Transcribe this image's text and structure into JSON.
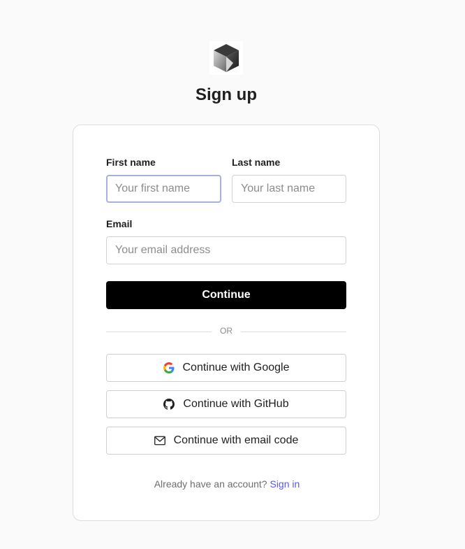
{
  "header": {
    "logo_icon": "cube-logo",
    "title": "Sign up"
  },
  "form": {
    "first_name": {
      "label": "First name",
      "value": "",
      "placeholder": "Your first name"
    },
    "last_name": {
      "label": "Last name",
      "value": "",
      "placeholder": "Your last name"
    },
    "email": {
      "label": "Email",
      "value": "",
      "placeholder": "Your email address"
    },
    "continue_label": "Continue",
    "divider_text": "OR"
  },
  "social": {
    "google_label": "Continue with Google",
    "google_icon": "google-icon",
    "github_label": "Continue with GitHub",
    "github_icon": "github-icon",
    "email_code_label": "Continue with email code",
    "email_code_icon": "mail-icon"
  },
  "footer": {
    "prompt": "Already have an account?",
    "signin_label": "Sign in"
  },
  "colors": {
    "primary_button": "#000000",
    "link": "#5b5bd6",
    "focus_border": "#a8b0e0"
  }
}
